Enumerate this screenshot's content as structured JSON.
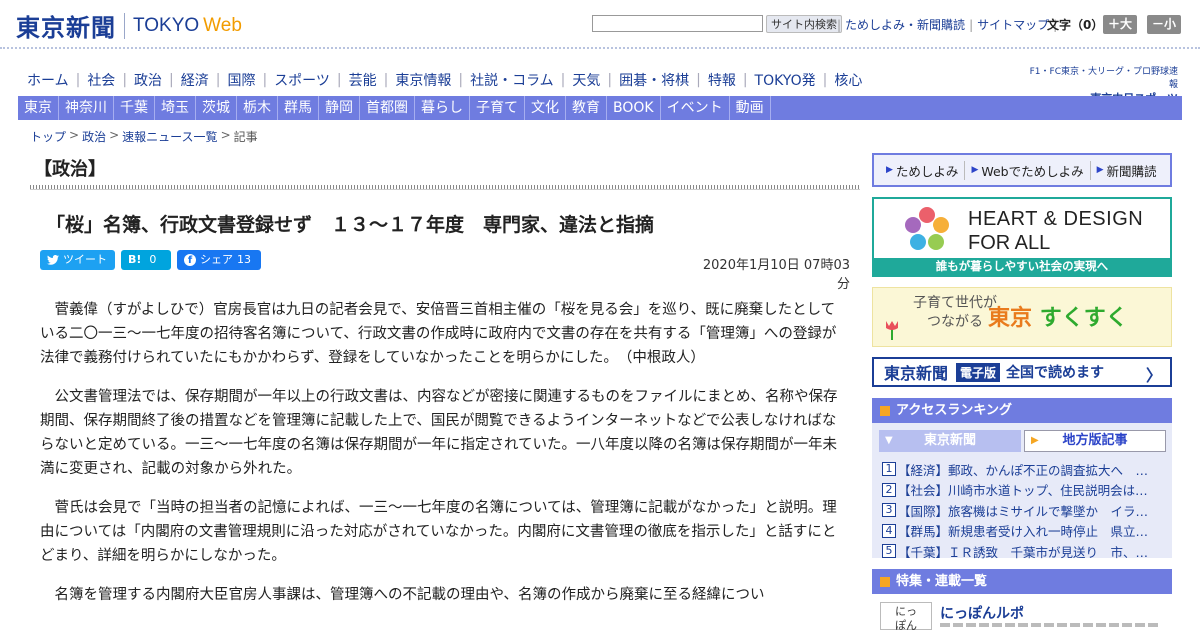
{
  "header": {
    "logo_jp": "東京新聞",
    "logo_en_1": "TOKYO",
    "logo_en_2": "Web",
    "search_button": "サイト内検索",
    "links": [
      "ためしよみ・新聞購読",
      "サイトマップ"
    ],
    "font_size_label": "文字（0）",
    "font_up": "＋大",
    "font_down": "－小"
  },
  "main_nav": [
    "ホーム",
    "社会",
    "政治",
    "経済",
    "国際",
    "スポーツ",
    "芸能",
    "東京情報",
    "社説・コラム",
    "天気",
    "囲碁・将棋",
    "特報",
    "TOKYO発",
    "核心"
  ],
  "sports_logo": {
    "line1": "F1・FC東京・大リーグ・プロ野球速報",
    "line2": "東京中日スポーツ"
  },
  "sub_nav": [
    "東京",
    "神奈川",
    "千葉",
    "埼玉",
    "茨城",
    "栃木",
    "群馬",
    "静岡",
    "首都圏",
    "暮らし",
    "子育て",
    "文化",
    "教育",
    "BOOK",
    "イベント",
    "動画"
  ],
  "breadcrumb": [
    "トップ",
    "政治",
    "速報ニュース一覧",
    "記事"
  ],
  "article": {
    "section": "【政治】",
    "title": "「桜」名簿、行政文書登録せず　１３～１７年度　専門家、違法と指摘",
    "date": "2020年1月10日 07時03分",
    "share": {
      "tweet": "ツイート",
      "hatena": "B!",
      "hatena_count": "0",
      "facebook": "シェア",
      "facebook_count": "13"
    },
    "paragraphs": [
      "菅義偉（すがよしひで）官房長官は九日の記者会見で、安倍晋三首相主催の「桜を見る会」を巡り、既に廃棄したとしている二〇一三～一七年度の招待客名簿について、行政文書の作成時に政府内で文書の存在を共有する「管理簿」への登録が法律で義務付けられていたにもかかわらず、登録をしていなかったことを明らかにした。　（中根政人）",
      "公文書管理法では、保存期間が一年以上の行政文書は、内容などが密接に関連するものをファイルにまとめ、名称や保存期間、保存期間終了後の措置などを管理簿に記載した上で、国民が閲覧できるようインターネットなどで公表しなければならないと定めている。一三～一七年度の名簿は保存期間が一年に指定されていた。一八年度以降の名簿は保存期間が一年未満に変更され、記載の対象から外れた。",
      "菅氏は会見で「当時の担当者の記憶によれば、一三～一七年度の名簿については、管理簿に記載がなかった」と説明。理由については「内閣府の文書管理規則に沿った対応がされていなかった。内閣府に文書管理の徹底を指示した」と話すにとどまり、詳細を明らかにしなかった。",
      "名簿を管理する内閣府大臣官房人事課は、管理簿への不記載の理由や、名簿の作成から廃棄に至る経緯につい"
    ]
  },
  "sidebar": {
    "trial_links": [
      "ためしよみ",
      "Webでためしよみ",
      "新聞購読"
    ],
    "hd4a": {
      "line1": "HEART & DESIGN",
      "line2": "FOR ALL",
      "caption": "誰もが暮らしやすい社会の実現へ"
    },
    "sukusuku": {
      "small1": "子育て世代が",
      "small2": "つながる",
      "big1": "東京",
      "big2": "すくすく"
    },
    "denshi": {
      "logo": "東京新聞",
      "tag": "電子版",
      "text": "全国で読めます",
      "arrow": "〉"
    },
    "ranking": {
      "title": "アクセスランキング",
      "tab_active": "東京新聞",
      "tab_other": "地方版記事",
      "items": [
        {
          "num": "1",
          "text": "【経済】郵政、かんぽ不正の調査拡大へ　…"
        },
        {
          "num": "2",
          "text": "【社会】川崎市水道トップ、住民説明会は…"
        },
        {
          "num": "3",
          "text": "【国際】旅客機はミサイルで撃墜か　イラ…"
        },
        {
          "num": "4",
          "text": "【群馬】新規患者受け入れ一時停止　県立…"
        },
        {
          "num": "5",
          "text": "【千葉】ＩＲ誘致　千葉市が見送り　市、…"
        }
      ]
    },
    "features": {
      "title": "特集・連載一覧",
      "item_thumb_1": "にっ",
      "item_thumb_2": "ぽん",
      "item_title": "にっぽんルポ"
    }
  },
  "colors": {
    "brand_navy": "#1b3e96",
    "nav_purple": "#6f7ce0",
    "accent_orange": "#f29c00",
    "teal": "#1fa99a"
  }
}
